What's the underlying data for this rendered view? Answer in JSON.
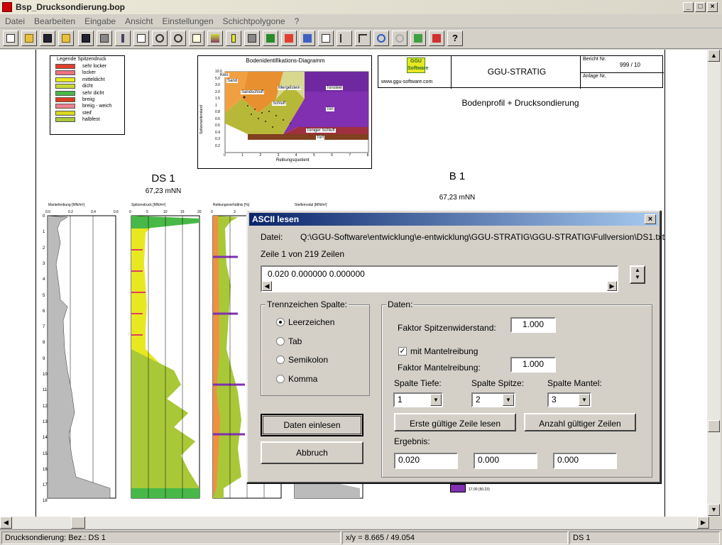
{
  "window": {
    "title": "Bsp_Drucksondierung.bop",
    "min": "_",
    "max": "□",
    "close": "×"
  },
  "menu": [
    "Datei",
    "Bearbeiten",
    "Eingabe",
    "Ansicht",
    "Einstellungen",
    "Schichtpolygone",
    "?"
  ],
  "legend": {
    "title": "Legende Spitzendruck",
    "items": [
      {
        "label": "sehr locker",
        "color": "#e0402a"
      },
      {
        "label": "locker",
        "color": "#f07080"
      },
      {
        "label": "mitteldicht",
        "color": "#e8e820"
      },
      {
        "label": "dicht",
        "color": "#c8d838"
      },
      {
        "label": "sehr dicht",
        "color": "#48b848"
      },
      {
        "label": "breiig",
        "color": "#d84020"
      },
      {
        "label": "breiig - weich",
        "color": "#f08090"
      },
      {
        "label": "steif",
        "color": "#d8d820"
      },
      {
        "label": "halbfest",
        "color": "#a8c838"
      }
    ]
  },
  "diagram": {
    "title": "Bodenidentifikations-Diagramm",
    "ylabel": "Spitzenwiderstand",
    "xlabel": "Reibungsquotient",
    "yticks": [
      "10.0",
      "5.0",
      "3.0",
      "2.0",
      "1.5",
      "1",
      "0.8",
      "0.6",
      "0.5",
      "0.4",
      "0.3",
      "0.2"
    ],
    "xticks": [
      "0",
      "1",
      "2",
      "3",
      "4",
      "5",
      "6",
      "7",
      "8"
    ],
    "zones": [
      "Kies",
      "Sand",
      "Mergelstein",
      "Tonstein",
      "Sandschluff",
      "Schluff",
      "Ton",
      "Toniger Schluff",
      "Torf"
    ]
  },
  "titleblock": {
    "company": "GGU-STRATIG",
    "url": "www.ggu-software.com",
    "report_label": "Bericht Nr.",
    "report_no": "999 / 10",
    "annex_label": "Anlage Nr.",
    "subtitle": "Bodenprofil + Drucksondierung",
    "logo": "GGU Software"
  },
  "profile_left": {
    "name": "DS 1",
    "elev": "67,23 mNN"
  },
  "profile_right": {
    "name": "B 1",
    "elev": "67,23 mNN"
  },
  "tracks": [
    {
      "label": "Mantelreibung [MN/m²]",
      "ticks": [
        "0.0",
        "0.2",
        "0.4",
        "0.6"
      ]
    },
    {
      "label": "Spitzendruck [MN/m²]",
      "ticks": [
        "0",
        "5",
        "10",
        "15",
        "20"
      ]
    },
    {
      "label": "Reibungsverhältnis [%]",
      "ticks": [
        "0",
        "3",
        "6",
        "9"
      ]
    },
    {
      "label": "Steifemodul [MN/m²]",
      "ticks": []
    }
  ],
  "depth_ticks": [
    "0",
    "1",
    "2",
    "3",
    "4",
    "5",
    "6",
    "7",
    "8",
    "9",
    "10",
    "11",
    "12",
    "13",
    "14",
    "15",
    "16",
    "17",
    "18"
  ],
  "bottom_label": "17.00 (50.23)",
  "dialog": {
    "title": "ASCII lesen",
    "file_label": "Datei:",
    "file_path": "Q:\\GGU-Software\\entwicklung\\e-entwicklung\\GGU-STRATIG\\GGU-STRATIG\\Fullversion\\DS1.txt",
    "line_info": "Zeile 1 von 219 Zeilen",
    "line_content": "0.020     0.000000     0.000000",
    "sep_group": "Trennzeichen Spalte:",
    "sep": [
      {
        "label": "Leerzeichen",
        "on": true
      },
      {
        "label": "Tab",
        "on": false
      },
      {
        "label": "Semikolon",
        "on": false
      },
      {
        "label": "Komma",
        "on": false
      }
    ],
    "data_group": "Daten:",
    "factor_tip_label": "Faktor Spitzenwiderstand:",
    "factor_tip": "1.000",
    "mantel_check": "mit Mantelreibung",
    "factor_mantel_label": "Faktor Mantelreibung:",
    "factor_mantel": "1.000",
    "col_depth_label": "Spalte Tiefe:",
    "col_depth": "1",
    "col_tip_label": "Spalte Spitze:",
    "col_tip": "2",
    "col_mantel_label": "Spalte Mantel:",
    "col_mantel": "3",
    "btn_first": "Erste gültige Zeile lesen",
    "btn_count": "Anzahl gültiger Zeilen",
    "result_label": "Ergebnis:",
    "results": [
      "0.020",
      "0.000",
      "0.000"
    ],
    "btn_read": "Daten einlesen",
    "btn_cancel": "Abbruch"
  },
  "status": {
    "left": "Drucksondierung: Bez.: DS 1",
    "coords": "x/y = 8.665  /  49.054",
    "right": "DS 1"
  }
}
